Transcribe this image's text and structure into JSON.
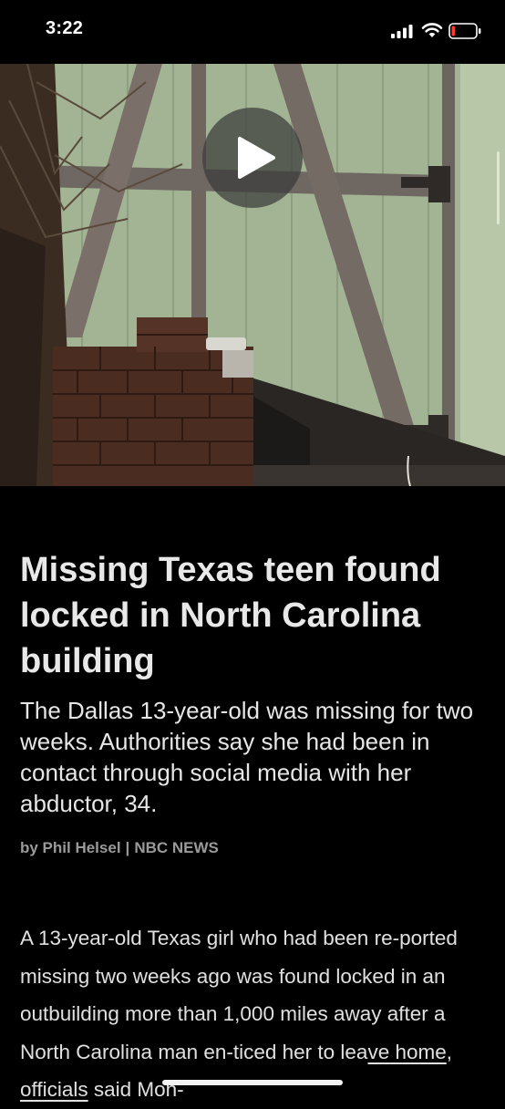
{
  "status_bar": {
    "time": "3:22",
    "icons": [
      "signal-icon",
      "wifi-icon",
      "battery-icon"
    ]
  },
  "video": {
    "play_icon": "play-icon",
    "scene": "shed-door-brick-wall"
  },
  "article": {
    "headline": "Missing Texas teen found locked in North Carolina building",
    "dek": "The Dallas 13-year-old was missing for two weeks. Authorities say she had been in contact through social media with her abductor, 34.",
    "byline": {
      "author": "by Phil Helsel",
      "separator": "|",
      "source": "NBC NEWS"
    },
    "body": {
      "text_start": "A 13-year-old Texas girl who had been re-ported missing two weeks ago was found locked in an outbuilding more than 1,000 miles away after a North Carolina man en-ticed her to lea",
      "link_1": "ve home",
      "text_mid": ", ",
      "link_2": "officials",
      "text_end": " said Mon-"
    }
  },
  "colors": {
    "background": "#000000",
    "headline": "#e8e8e8",
    "byline": "#9a9a9a",
    "door_green": "#a9b99a",
    "brick": "#4a2c20"
  }
}
